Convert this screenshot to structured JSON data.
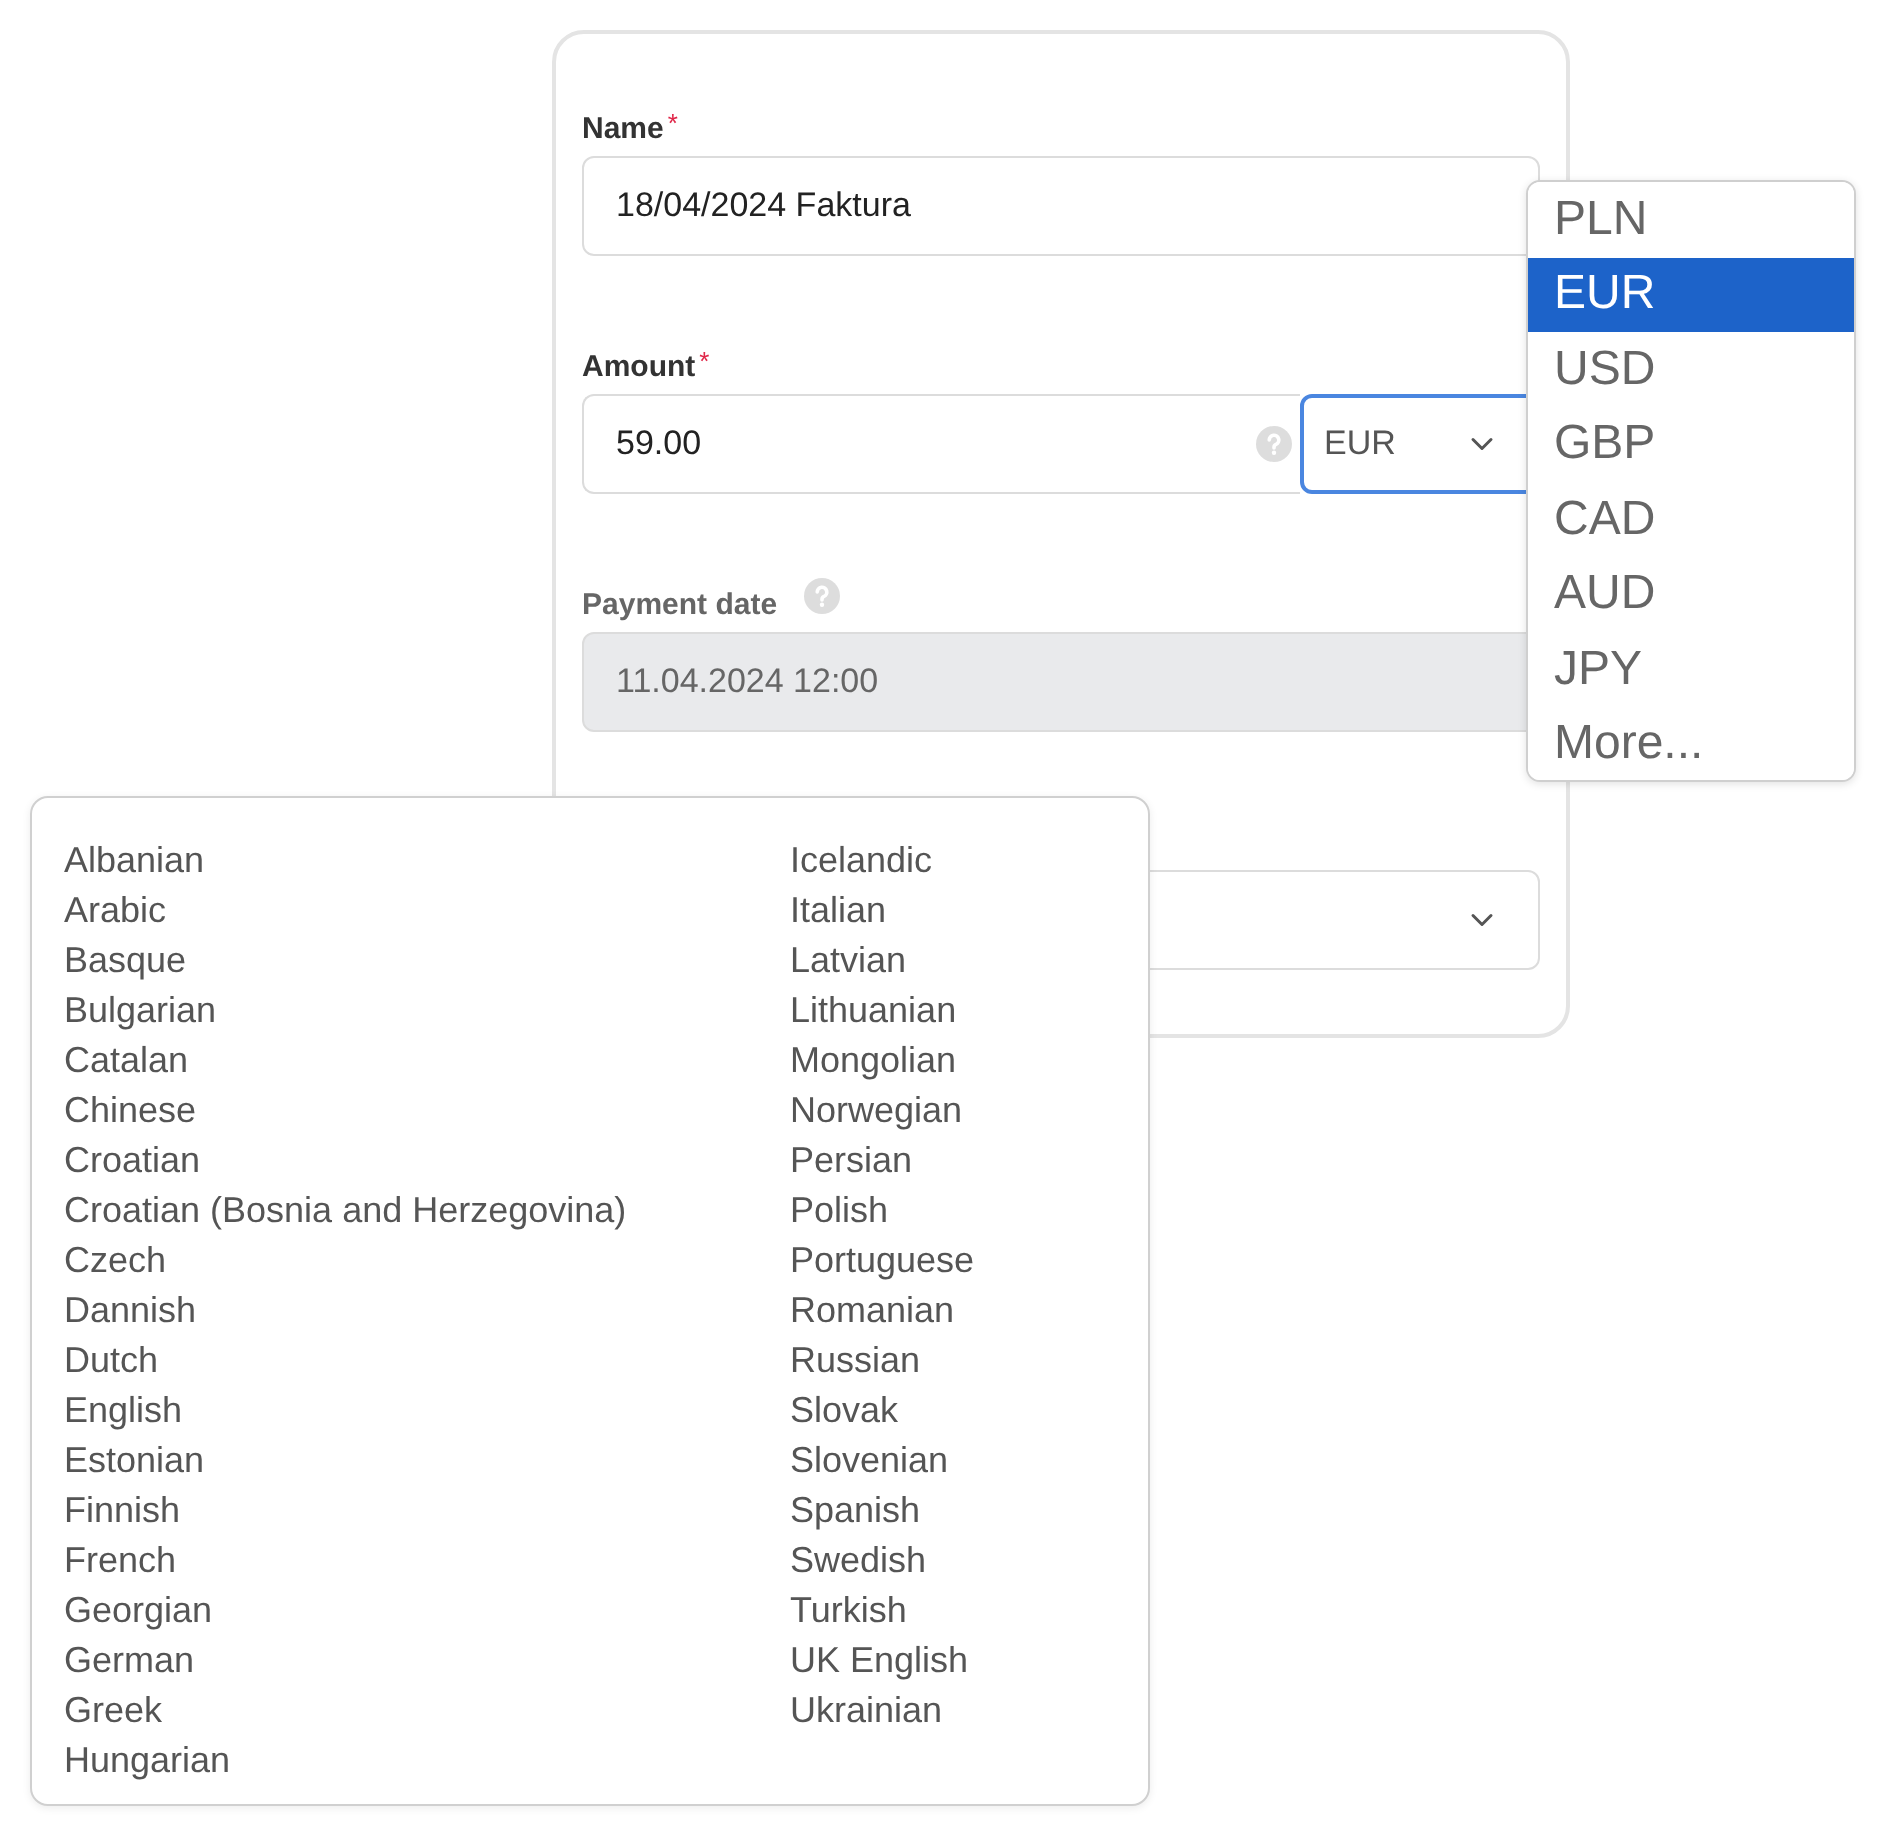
{
  "form": {
    "fields": [
      {
        "kind": "text",
        "label": "Name",
        "required_mark": "*",
        "value": "18/04/2024 Faktura"
      },
      {
        "kind": "amount",
        "label": "Amount",
        "required_mark": "*",
        "value": "59.00",
        "help": true,
        "currency": {
          "value": "EUR",
          "focused": true
        }
      },
      {
        "kind": "date",
        "label": "Payment date",
        "help": true,
        "value": "11.04.2024 12:00",
        "disabled": true
      },
      {
        "kind": "select"
      }
    ]
  },
  "currency_menu": {
    "items": [
      {
        "label": "PLN",
        "selected": false
      },
      {
        "label": "EUR",
        "selected": true
      },
      {
        "label": "USD",
        "selected": false
      },
      {
        "label": "GBP",
        "selected": false
      },
      {
        "label": "CAD",
        "selected": false
      },
      {
        "label": "AUD",
        "selected": false
      },
      {
        "label": "JPY",
        "selected": false
      },
      {
        "label": "More...",
        "selected": false
      }
    ]
  },
  "language_list": {
    "columns": [
      {
        "items": [
          "Albanian",
          "Arabic",
          "Basque",
          "Bulgarian",
          "Catalan",
          "Chinese",
          "Croatian",
          "Croatian (Bosnia and Herzegovina)",
          "Czech",
          "Dannish",
          "Dutch",
          "English",
          "Estonian",
          "Finnish",
          "French",
          "Georgian",
          "German",
          "Greek",
          "Hungarian"
        ]
      },
      {
        "items": [
          "Icelandic",
          "Italian",
          "Latvian",
          "Lithuanian",
          "Mongolian",
          "Norwegian",
          "Persian",
          "Polish",
          "Portuguese",
          "Romanian",
          "Russian",
          "Slovak",
          "Slovenian",
          "Spanish",
          "Swedish",
          "Turkish",
          "UK English",
          "Ukrainian"
        ]
      }
    ]
  }
}
